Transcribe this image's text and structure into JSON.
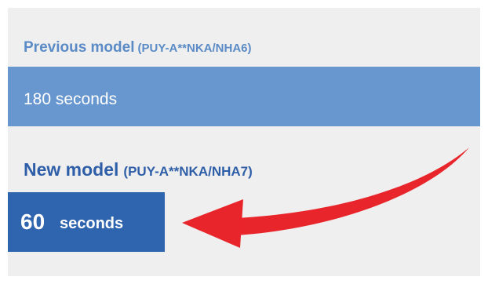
{
  "previous_model": {
    "label": "Previous model",
    "code": "(PUY-A**NKA/NHA6)",
    "value": "180 seconds"
  },
  "new_model": {
    "label": "New model",
    "code": "(PUY-A**NKA/NHA7)",
    "value_number": "60",
    "value_unit": "seconds"
  },
  "colors": {
    "panel_background": "#efefef",
    "previous_text": "#5a8bc6",
    "previous_bar": "#6897cf",
    "new_text": "#2e5ea8",
    "new_badge": "#2f64ae",
    "arrow": "#e8252a"
  },
  "icons": {
    "arrow": "curved-arrow-icon"
  }
}
